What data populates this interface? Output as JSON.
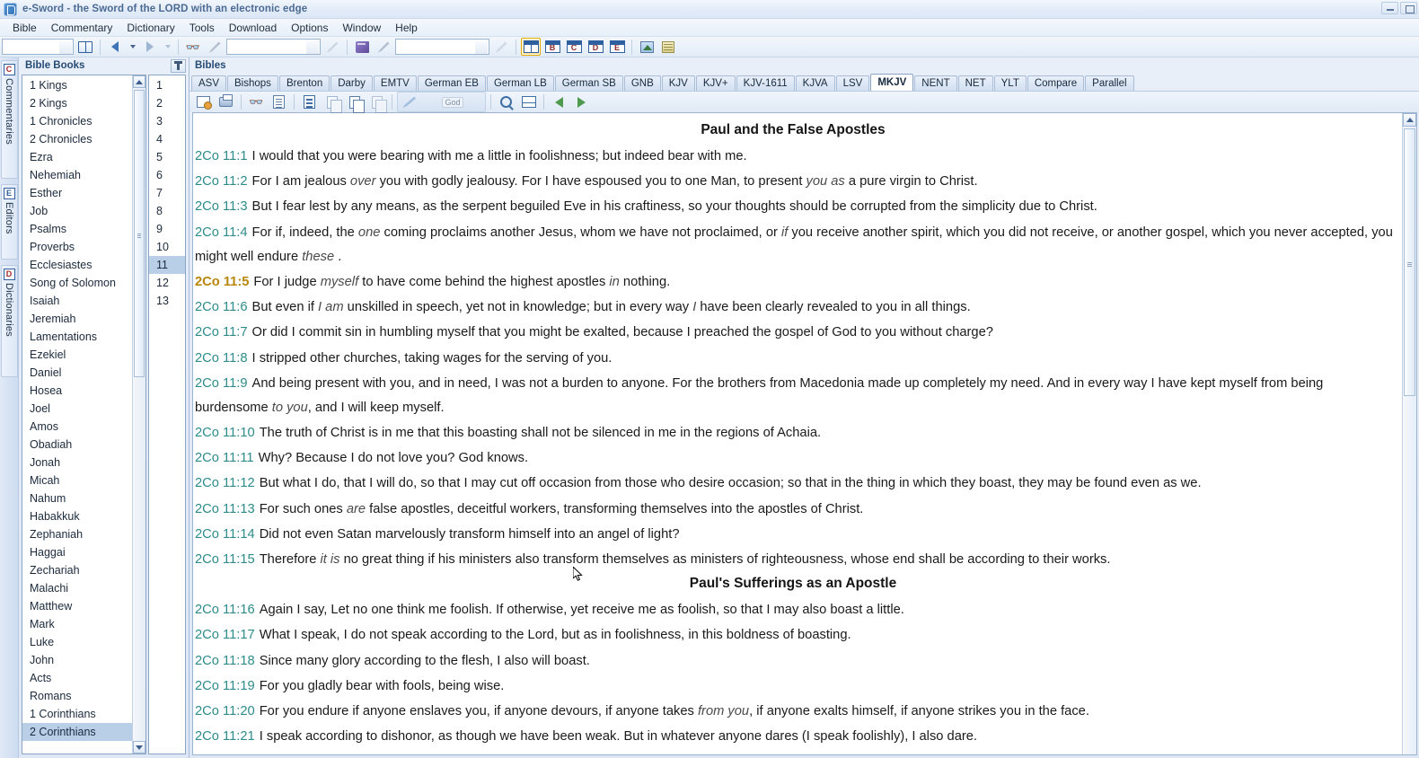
{
  "window": {
    "title": "e-Sword - the Sword of the LORD with an electronic edge",
    "app_icon": "sword-app-icon",
    "minimize_label": "",
    "maximize_label": ""
  },
  "menu": {
    "items": [
      "Bible",
      "Commentary",
      "Dictionary",
      "Tools",
      "Download",
      "Options",
      "Window",
      "Help"
    ]
  },
  "toolbar": {
    "combo1_value": "",
    "combo2_value": "",
    "combo3_value": "",
    "icons": [
      "open-book-icon",
      "nav-back-icon",
      "nav-forward-icon",
      "binoculars-search-icon",
      "search-go-icon",
      "purple-book-icon",
      "pen-icon",
      "go-icon",
      "layout-default-icon",
      "layout-b-icon",
      "layout-c-icon",
      "layout-d-icon",
      "layout-e-icon",
      "graphics-icon",
      "calendar-icon"
    ],
    "layout_letters": [
      "B",
      "C",
      "D",
      "E"
    ]
  },
  "vtabs": [
    {
      "letter": "C",
      "label": "Commentaries",
      "color": "#a52a2a"
    },
    {
      "letter": "E",
      "label": "Editors",
      "color": "#2f5f9e"
    },
    {
      "letter": "D",
      "label": "Dictionaries",
      "color": "#a52a2a"
    }
  ],
  "books_panel": {
    "title": "Bible Books",
    "pin_icon": "pin-icon",
    "books": [
      "1 Kings",
      "2 Kings",
      "1 Chronicles",
      "2 Chronicles",
      "Ezra",
      "Nehemiah",
      "Esther",
      "Job",
      "Psalms",
      "Proverbs",
      "Ecclesiastes",
      "Song of Solomon",
      "Isaiah",
      "Jeremiah",
      "Lamentations",
      "Ezekiel",
      "Daniel",
      "Hosea",
      "Joel",
      "Amos",
      "Obadiah",
      "Jonah",
      "Micah",
      "Nahum",
      "Habakkuk",
      "Zephaniah",
      "Haggai",
      "Zechariah",
      "Malachi",
      "Matthew",
      "Mark",
      "Luke",
      "John",
      "Acts",
      "Romans",
      "1 Corinthians",
      "2 Corinthians"
    ],
    "selected_book": "2 Corinthians",
    "chapters": [
      "1",
      "2",
      "3",
      "4",
      "5",
      "6",
      "7",
      "8",
      "9",
      "10",
      "11",
      "12",
      "13"
    ],
    "selected_chapter": "11"
  },
  "bibles_panel": {
    "title": "Bibles",
    "tabs": [
      "ASV",
      "Bishops",
      "Brenton",
      "Darby",
      "EMTV",
      "German EB",
      "German LB",
      "German SB",
      "GNB",
      "KJV",
      "KJV+",
      "KJV-1611",
      "KJVA",
      "LSV",
      "MKJV",
      "NENT",
      "NET",
      "YLT",
      "Compare",
      "Parallel"
    ],
    "active_tab": "MKJV",
    "toolbar_icons": [
      "new-note-icon",
      "print-icon",
      "search-icon",
      "find-verse-icon",
      "topic-icon",
      "copy-verse-icon",
      "copy-with-ref-icon",
      "paste-icon",
      "highlight-icon",
      "strongs-numbers-icon",
      "zoom-icon",
      "split-view-icon",
      "previous-chapter-icon",
      "next-chapter-icon"
    ],
    "strongs_label": "God"
  },
  "content": {
    "heading1": "Paul and the False Apostles",
    "heading2": "Paul's Sufferings as an Apostle",
    "current_verse_ref": "2Co 11:5",
    "verses_part1": [
      {
        "ref": "2Co 11:1",
        "current": false,
        "html": "I would that you were bearing with me a little in foolishness; but indeed bear with me."
      },
      {
        "ref": "2Co 11:2",
        "current": false,
        "html": "For I am jealous <i>over</i> you with godly jealousy. For I have espoused you to one Man, to present <i>you as</i> a pure virgin to Christ."
      },
      {
        "ref": "2Co 11:3",
        "current": false,
        "html": "But I fear lest by any means, as the serpent beguiled Eve in his craftiness, so your thoughts should be corrupted from the simplicity due to Christ."
      },
      {
        "ref": "2Co 11:4",
        "current": false,
        "html": "For if, indeed, the <i>one</i> coming proclaims another Jesus, whom we have not proclaimed, or <i>if</i> you receive another spirit, which you did not receive, or another gospel, which you never accepted, you might well endure <i>these</i> ."
      },
      {
        "ref": "2Co 11:5",
        "current": true,
        "html": "For I judge <i>myself</i> to have come behind the highest apostles <i>in</i> nothing."
      },
      {
        "ref": "2Co 11:6",
        "current": false,
        "html": "But even if <i>I am</i> unskilled in speech, yet not in knowledge; but in every way <i>I</i> have been clearly revealed to you in all things."
      },
      {
        "ref": "2Co 11:7",
        "current": false,
        "html": "Or did I commit sin in humbling myself that you might be exalted, because I preached the gospel of God to you without charge?"
      },
      {
        "ref": "2Co 11:8",
        "current": false,
        "html": "I stripped other churches, taking wages for the serving of you."
      },
      {
        "ref": "2Co 11:9",
        "current": false,
        "html": "And being present with you, and in need, I was not a burden to anyone. For the brothers from Macedonia made up completely my need. And in every way I have kept myself from being burdensome <i>to you</i>, and I will keep myself."
      },
      {
        "ref": "2Co 11:10",
        "current": false,
        "html": "The truth of Christ is in me that this boasting shall not be silenced in me in the regions of Achaia."
      },
      {
        "ref": "2Co 11:11",
        "current": false,
        "html": "Why? Because I do not love you? God knows."
      },
      {
        "ref": "2Co 11:12",
        "current": false,
        "html": "But what I do, that I will do, so that I may cut off occasion from those who desire occasion; so that in the thing in which they boast, they may be found even as we."
      },
      {
        "ref": "2Co 11:13",
        "current": false,
        "html": "For such ones <i>are</i> false apostles, deceitful workers, transforming themselves into the apostles of Christ."
      },
      {
        "ref": "2Co 11:14",
        "current": false,
        "html": "Did not even Satan marvelously transform himself into an angel of light?"
      },
      {
        "ref": "2Co 11:15",
        "current": false,
        "html": "Therefore <i>it is</i> no great thing if his ministers also transform themselves as ministers of righteousness, whose end shall be according to their works."
      }
    ],
    "verses_part2": [
      {
        "ref": "2Co 11:16",
        "current": false,
        "html": "Again I say, Let no one think me foolish. If otherwise, yet receive me as foolish, so that I may also boast a little."
      },
      {
        "ref": "2Co 11:17",
        "current": false,
        "html": "What I speak, I do not speak according to the Lord, but as in foolishness, in this boldness of boasting."
      },
      {
        "ref": "2Co 11:18",
        "current": false,
        "html": "Since many glory according to the flesh, I also will boast."
      },
      {
        "ref": "2Co 11:19",
        "current": false,
        "html": "For you gladly bear with fools, being wise."
      },
      {
        "ref": "2Co 11:20",
        "current": false,
        "html": "For you endure if anyone enslaves you, if anyone devours, if anyone takes <i>from you</i>, if anyone exalts himself, if anyone strikes you in the face."
      },
      {
        "ref": "2Co 11:21",
        "current": false,
        "html": "I speak according to dishonor, as though we have been weak. But in whatever anyone dares (I speak foolishly), I also dare."
      }
    ]
  },
  "colors": {
    "verse_ref": "#2d8b8b",
    "current_verse_ref": "#b8860b",
    "panel_title": "#274a75",
    "chrome": "#dde7f5"
  }
}
